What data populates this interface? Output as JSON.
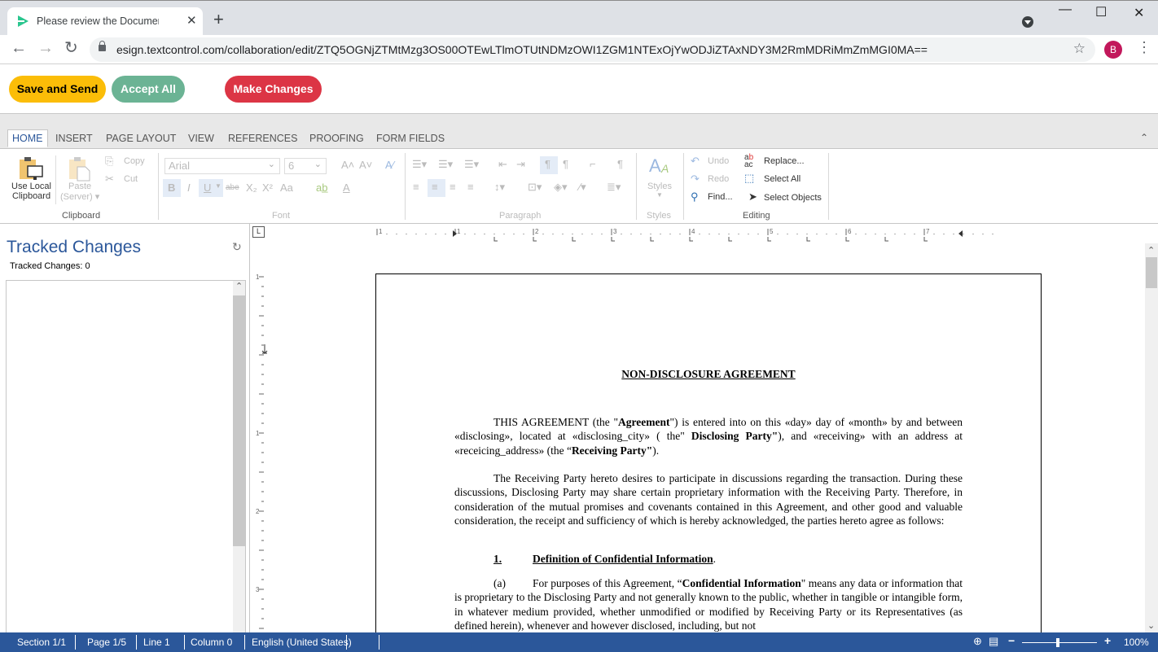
{
  "browser": {
    "tab_title": "Please review the Document - Te",
    "tab_close": "✕",
    "new_tab": "+",
    "url": "esign.textcontrol.com/collaboration/edit/ZTQ5OGNjZTMtMzg3OS00OTEwLTlmOTUtNDMzOWI1ZGM1NTExOjYwODJiZTAxNDY3M2RmMDRiMmZmMGI0MA==",
    "profile_initial": "B",
    "window_controls": {
      "minimize": "—",
      "maximize": "☐",
      "close": "✕"
    },
    "nav": {
      "back": "←",
      "forward": "→",
      "reload": "↻"
    },
    "star": "☆",
    "menu": "⋮"
  },
  "actions": {
    "save_and_send": "Save and Send",
    "accept_all": "Accept All",
    "make_changes": "Make Changes",
    "colors": {
      "save": "#fbbd08",
      "accept": "#6bb394",
      "make": "#dc3545"
    }
  },
  "ribbon": {
    "tabs": [
      "HOME",
      "INSERT",
      "PAGE LAYOUT",
      "VIEW",
      "REFERENCES",
      "PROOFING",
      "FORM FIELDS"
    ],
    "active_tab": "HOME",
    "collapse_icon": "⌃",
    "clipboard": {
      "label": "Clipboard",
      "use_local_line1": "Use Local",
      "use_local_line2": "Clipboard",
      "paste_line1": "Paste",
      "paste_line2": "(Server) ▾",
      "copy": "Copy",
      "cut": "Cut"
    },
    "font": {
      "label": "Font",
      "font_name": "Arial",
      "font_size": "6",
      "bold": "B",
      "italic": "I",
      "underline": "U",
      "strike": "abe",
      "subscript": "X₂",
      "superscript": "X²",
      "case": "Aa"
    },
    "paragraph": {
      "label": "Paragraph"
    },
    "styles": {
      "label": "Styles",
      "button": "Styles"
    },
    "editing": {
      "label": "Editing",
      "undo": "Undo",
      "redo": "Redo",
      "find": "Find...",
      "replace": "Replace...",
      "select_all": "Select All",
      "select_objects": "Select Objects"
    }
  },
  "tracked_changes": {
    "title": "Tracked Changes",
    "count_label": "Tracked Changes: 0"
  },
  "ruler": {
    "h_labels": [
      "1",
      "1",
      "2",
      "3",
      "4",
      "5",
      "6",
      "7"
    ],
    "v_labels": [
      "1",
      "1",
      "2",
      "3"
    ]
  },
  "document": {
    "title": "NON-DISCLOSURE AGREEMENT",
    "p1": {
      "a": "THIS AGREEMENT (the \"",
      "b": "Agreement",
      "c": "\") is entered into on this «day» day of «month» by and between «disclosing», located at «disclosing_city» ( the\" ",
      "d": "Disclosing Party\"",
      "e": "), and «receiving» with an address at «receicing_address» (the “",
      "f": "Receiving Party\"",
      "g": ")."
    },
    "p2": "The Receiving Party hereto desires to participate in discussions regarding the transaction. During these discussions, Disclosing Party may share certain proprietary information with the Receiving Party.  Therefore, in consideration of the mutual promises and covenants contained in this Agreement, and other good and valuable consideration, the receipt and sufficiency of which is hereby acknowledged, the parties hereto agree as follows:",
    "section1": {
      "number": "1.",
      "heading": "Definition of Confidential Information",
      "after": "."
    },
    "p3": {
      "label": "(a)",
      "a": "For purposes of this Agreement, “",
      "b": "Confidential Information",
      "c": "\" means any data or information that is proprietary to the Disclosing Party and not generally known to the public, whether in tangible or intangible form, in whatever medium provided, whether unmodified or modified by Receiving Party or its Representatives (as defined herein), whenever and however disclosed, including, but not"
    }
  },
  "statusbar": {
    "section": "Section 1/1",
    "page": "Page 1/5",
    "line": "Line 1",
    "column": "Column 0",
    "language": "English (United States)",
    "zoom_percent": 100,
    "zoom_label": "100%",
    "zoom_minus": "−",
    "zoom_plus": "+"
  }
}
